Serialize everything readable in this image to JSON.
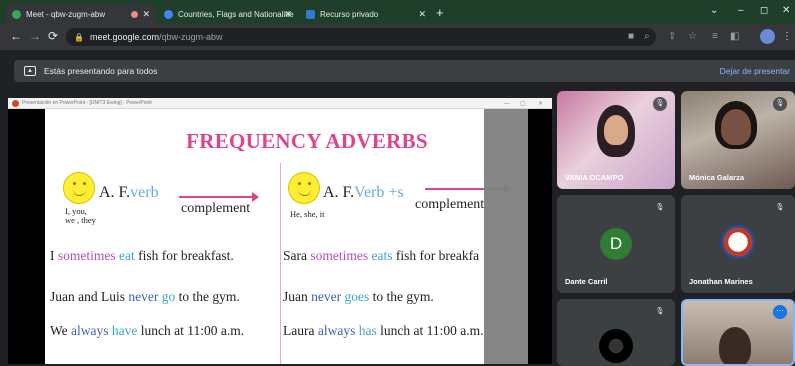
{
  "browser": {
    "tabs": [
      {
        "title": "Meet - qbw-zugm-abw",
        "active": true,
        "recording": true
      },
      {
        "title": "Countries, Flags and Nationalitie",
        "active": false
      },
      {
        "title": "Recurso privado",
        "active": false
      }
    ],
    "new_tab": "+",
    "window_controls": [
      "⌄",
      "–",
      "◻",
      "✕"
    ],
    "url_host": "meet.google.com",
    "url_path": "/qbw-zugm-abw"
  },
  "meet": {
    "presenting_text": "Estás presentando para todos",
    "stop_presenting": "Dejar de presentar",
    "shared_window_title": "Presentación en PowerPoint - [UNIT3 Ewing] - PowerPoint",
    "slide": {
      "title": "FREQUENCY ADVERBS",
      "rule_a": {
        "prefix": "A. F.",
        "verb": "verb",
        "complement": "complement",
        "subjects": [
          "I, you,",
          "we , they"
        ]
      },
      "rule_b": {
        "prefix": "A. F.",
        "verb": "Verb +s",
        "complement": "complement",
        "subjects": [
          "He, she, it"
        ]
      },
      "left_sentences": [
        {
          "pre": "I ",
          "adverb": "sometimes",
          "mid": " ",
          "verb": "eat",
          "post": " fish for breakfast."
        },
        {
          "pre": "Juan and Luis ",
          "adverb": "never",
          "mid": " ",
          "verb": "go",
          "post": " to the gym."
        },
        {
          "pre": "We ",
          "adverb": "always",
          "mid": " ",
          "verb": "have",
          "post": " lunch at 11:00 a.m."
        }
      ],
      "right_sentences": [
        {
          "pre": "Sara ",
          "adverb": "sometimes",
          "mid": " ",
          "verb": "eats",
          "post": " fish for breakfa"
        },
        {
          "pre": "Juan ",
          "adverb": "never",
          "mid": " ",
          "verb": "goes",
          "post": " to the gym."
        },
        {
          "pre": "Laura ",
          "adverb": "always",
          "mid": " ",
          "verb": "has",
          "post": " lunch at 11:00 a.m."
        }
      ]
    },
    "participants": [
      {
        "name": "VANIA OCAMPO"
      },
      {
        "name": "Mónica Galarza"
      },
      {
        "name": "Dante Carril",
        "initial": "D"
      },
      {
        "name": "Jonathan Marines"
      },
      {
        "name": ""
      },
      {
        "name": ""
      }
    ]
  }
}
